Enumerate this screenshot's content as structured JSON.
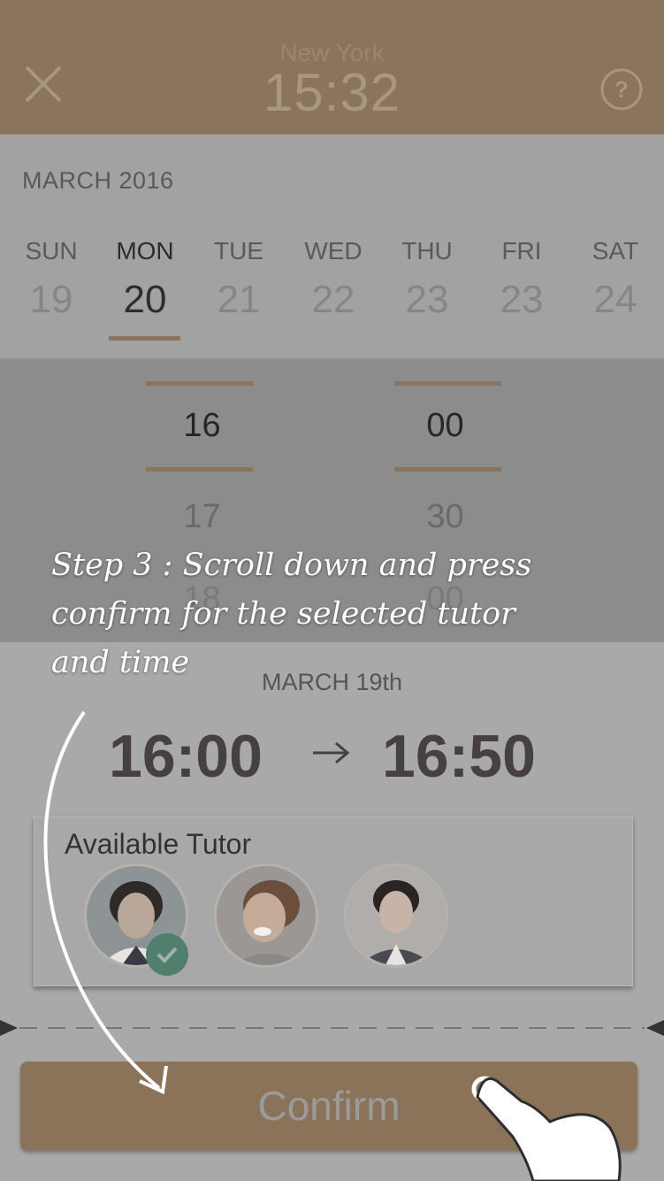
{
  "header": {
    "city": "New York",
    "time": "15:32",
    "close_icon": "close-icon",
    "help_icon": "help-icon",
    "color": "#8a745b"
  },
  "calendar": {
    "month": "MARCH 2016",
    "days": [
      {
        "dow": "SUN",
        "num": "19",
        "selected": false
      },
      {
        "dow": "MON",
        "num": "20",
        "selected": true
      },
      {
        "dow": "TUE",
        "num": "21",
        "selected": false
      },
      {
        "dow": "WED",
        "num": "22",
        "selected": false
      },
      {
        "dow": "THU",
        "num": "23",
        "selected": false
      },
      {
        "dow": "FRI",
        "num": "23",
        "selected": false
      },
      {
        "dow": "SAT",
        "num": "24",
        "selected": false
      }
    ]
  },
  "time_picker": {
    "hour": {
      "selected": "16",
      "next": "17",
      "faded": "18"
    },
    "minute": {
      "selected": "00",
      "next": "30",
      "faded": "00"
    }
  },
  "summary": {
    "date": "MARCH 19th",
    "start": "16:00",
    "end": "16:50",
    "arrow_icon": "arrow-right-icon"
  },
  "tutors": {
    "title": "Available Tutor",
    "items": [
      {
        "name": "tutor-1",
        "selected": true
      },
      {
        "name": "tutor-2",
        "selected": false
      },
      {
        "name": "tutor-3",
        "selected": false
      }
    ]
  },
  "confirm": {
    "label": "Confirm",
    "color": "#8a7358"
  },
  "instruction": {
    "line1": "Step 3 : Scroll down and press",
    "line2": "confirm for the selected tutor",
    "line3": "and time"
  }
}
